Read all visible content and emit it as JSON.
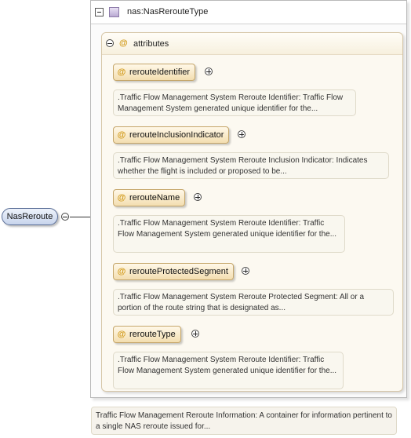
{
  "root": {
    "label": "NasReroute",
    "documentation": "Traffic Flow Management Reroute Information: A container for information pertinent to a single NAS reroute issued for..."
  },
  "type": {
    "label": "nas:NasRerouteType"
  },
  "attribute_group": {
    "symbol": "@",
    "label": "attributes"
  },
  "attributes": [
    {
      "symbol": "@",
      "name": "rerouteIdentifier",
      "documentation": ".Traffic Flow Management System Reroute Identifier: Traffic Flow Management System generated unique identifier for the..."
    },
    {
      "symbol": "@",
      "name": "rerouteInclusionIndicator",
      "documentation": ".Traffic Flow Management System Reroute Inclusion Indicator: Indicates whether the flight is included or proposed to be..."
    },
    {
      "symbol": "@",
      "name": "rerouteName",
      "documentation": ".Traffic Flow Management System Reroute Identifier: Traffic Flow Management System generated unique identifier for the..."
    },
    {
      "symbol": "@",
      "name": "rerouteProtectedSegment",
      "documentation": ".Traffic Flow Management System Reroute Protected Segment: All or a portion of the route string that is designated as..."
    },
    {
      "symbol": "@",
      "name": "rerouteType",
      "documentation": ".Traffic Flow Management System Reroute Identifier: Traffic Flow Management System generated unique identifier for the..."
    }
  ]
}
